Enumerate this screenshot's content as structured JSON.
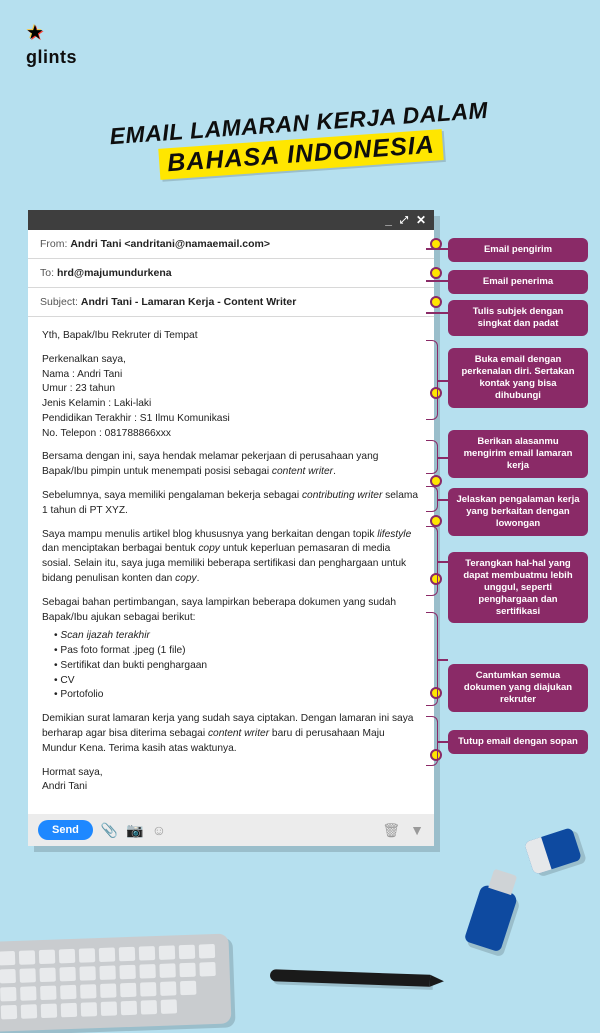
{
  "logo": {
    "text": "glints"
  },
  "title": {
    "line1": "EMAIL LAMARAN KERJA DALAM",
    "line2": "BAHASA INDONESIA"
  },
  "annotations": {
    "a1": "Email pengirim",
    "a2": "Email penerima",
    "a3": "Tulis subjek dengan singkat dan padat",
    "a4": "Buka email dengan perkenalan diri. Sertakan kontak yang bisa dihubungi",
    "a5": "Berikan alasanmu mengirim email lamaran kerja",
    "a6": "Jelaskan pengalaman kerja yang berkaitan dengan lowongan",
    "a7": "Terangkan hal-hal yang dapat membuatmu lebih unggul, seperti penghargaan dan sertifikasi",
    "a8": "Cantumkan semua dokumen yang diajukan rekruter",
    "a9": "Tutup email dengan sopan"
  },
  "email": {
    "from_lbl": "From:",
    "from_val": "Andri Tani <andritani@namaemail.com>",
    "to_lbl": "To:",
    "to_val": "hrd@majumundurkena",
    "subj_lbl": "Subject:",
    "subj_val": "Andri Tani - Lamaran Kerja - Content Writer",
    "greeting": "Yth, Bapak/Ibu Rekruter di Tempat",
    "intro0": "Perkenalkan saya,",
    "intro1": "Nama  : Andri Tani",
    "intro2": "Umur  : 23 tahun",
    "intro3": "Jenis Kelamin : Laki-laki",
    "intro4": "Pendidikan Terakhir  : S1 Ilmu Komunikasi",
    "intro5": "No. Telepon  : 081788866xxx",
    "attach_lead": "Sebagai bahan pertimbangan, saya lampirkan beberapa dokumen yang sudah Bapak/Ibu ajukan sebagai berikut:",
    "att1": "Scan ijazah terakhir",
    "att2": "Pas foto format .jpeg (1 file)",
    "att3": "Sertifikat dan bukti penghargaan",
    "att4": "CV",
    "att5": "Portofolio",
    "sign1": "Hormat saya,",
    "sign2": "Andri Tani",
    "send": "Send"
  }
}
